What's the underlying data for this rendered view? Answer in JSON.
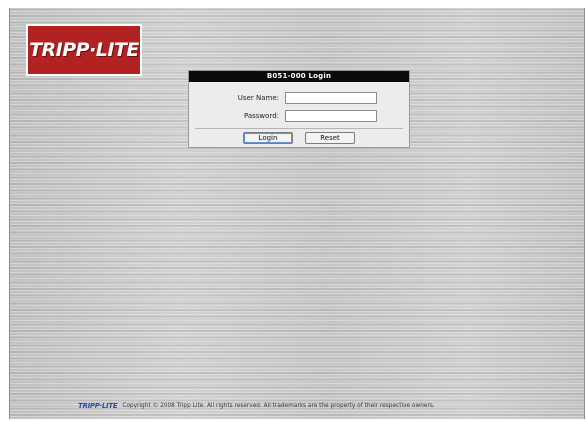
{
  "brand": {
    "logo_text": "TRIPP·LITE",
    "logo_color": "#b22222",
    "footer_logo_text": "TRIPP·LITE",
    "footer_logo_color": "#2a4fa8"
  },
  "login": {
    "title": "B051-000 Login",
    "username_label": "User Name:",
    "username_value": "",
    "password_label": "Password:",
    "password_value": "",
    "login_button": "Login",
    "reset_button": "Reset"
  },
  "footer": {
    "copyright": "Copyright © 2008 Tripp Lite. All rights reserved. All trademarks are the property of their respective owners."
  }
}
